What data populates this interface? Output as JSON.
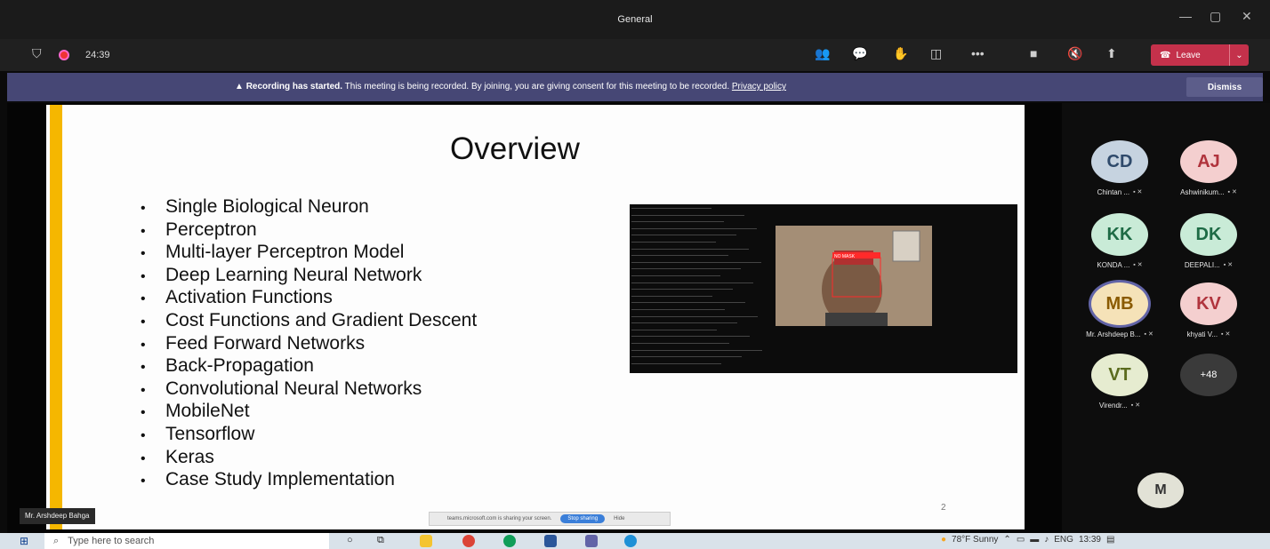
{
  "window": {
    "title": "General"
  },
  "meeting": {
    "timer": "24:39",
    "leave_label": "Leave"
  },
  "banner": {
    "bold": "Recording has started.",
    "text": " This meeting is being recorded. By joining, you are giving consent for this meeting to be recorded. ",
    "link": "Privacy policy",
    "dismiss_label": "Dismiss"
  },
  "slide": {
    "title": "Overview",
    "bullets": [
      "Single Biological Neuron",
      "Perceptron",
      "Multi-layer Perceptron Model",
      "Deep Learning Neural Network",
      "Activation Functions",
      "Cost Functions and Gradient Descent",
      "Feed Forward Networks",
      "Back-Propagation",
      "Convolutional Neural Networks",
      "MobileNet",
      "Tensorflow",
      "Keras",
      "Case Study Implementation"
    ],
    "page_number": "2",
    "webcam_label": "NO MASK"
  },
  "share_bar": {
    "text": "teams.microsoft.com is sharing your screen.",
    "stop_label": "Stop sharing",
    "hide_label": "Hide"
  },
  "presenter_label": "Mr. Arshdeep Bahga",
  "participants": [
    {
      "initials": "CD",
      "name": "Chintan ...",
      "bg": "#c6d3e0",
      "fg": "#2f4a6b"
    },
    {
      "initials": "AJ",
      "name": "Ashwinikum...",
      "bg": "#f4cfcf",
      "fg": "#b0343d"
    },
    {
      "initials": "KK",
      "name": "KONDA ...",
      "bg": "#c9ebd7",
      "fg": "#1e6b45"
    },
    {
      "initials": "DK",
      "name": "DEEPALI...",
      "bg": "#c9ebd7",
      "fg": "#1e6b45"
    },
    {
      "initials": "MB",
      "name": "Mr. Arshdeep B...",
      "bg": "#f5e2b8",
      "fg": "#8a5a00"
    },
    {
      "initials": "KV",
      "name": "khyati V...",
      "bg": "#f4cfcf",
      "fg": "#b0343d"
    },
    {
      "initials": "VT",
      "name": "Virendr...",
      "bg": "#e6ecd0",
      "fg": "#5b6b1e"
    },
    {
      "initials": "+48",
      "name": "",
      "bg": "#3a3a3a",
      "fg": "#ffffff"
    }
  ],
  "self_avatar": {
    "initials": "M"
  },
  "taskbar": {
    "search_placeholder": "Type here to search",
    "weather": "78°F  Sunny",
    "lang": "ENG",
    "time": "13:39"
  }
}
